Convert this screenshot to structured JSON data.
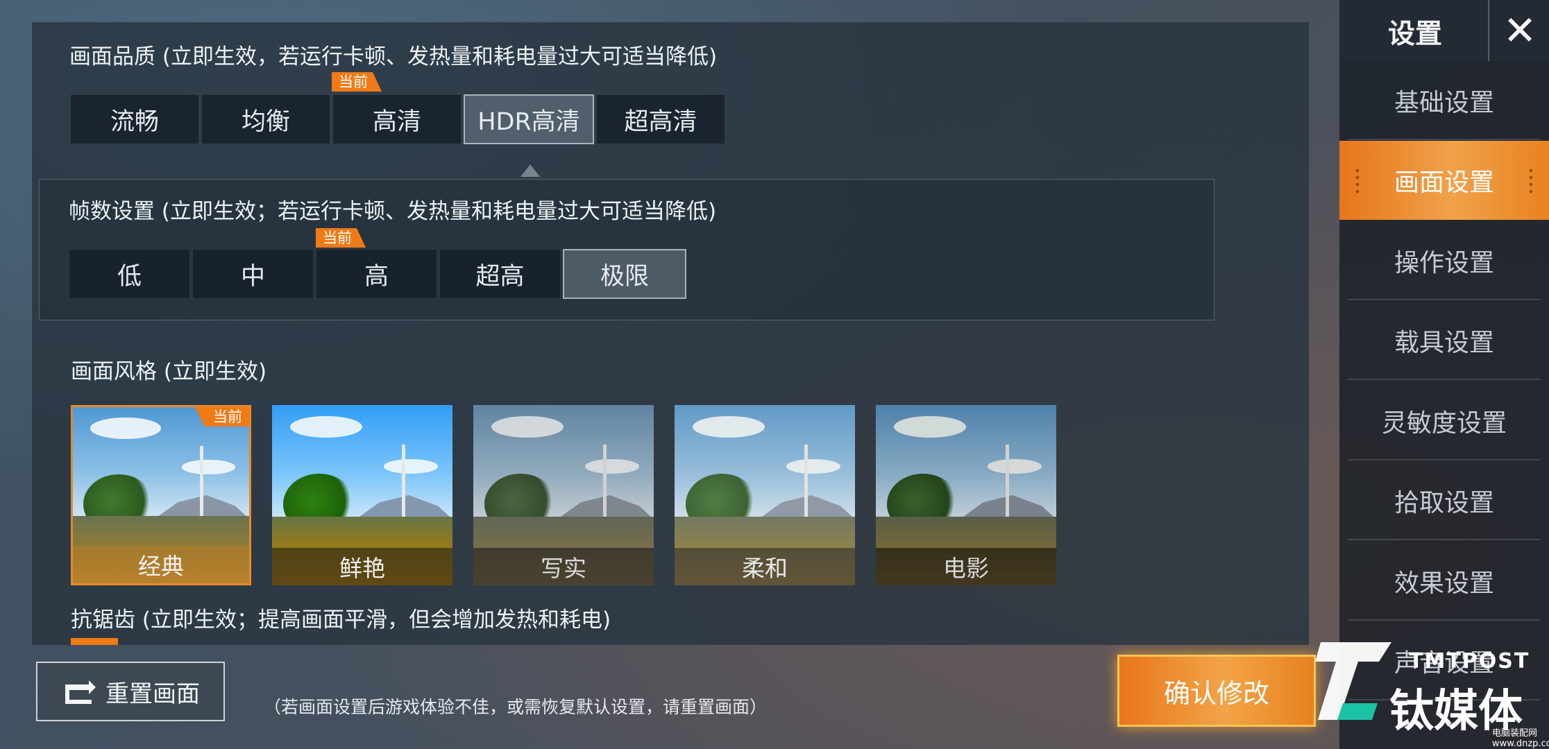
{
  "quality": {
    "title": "画面品质 (立即生效，若运行卡顿、发热量和耗电量过大可适当降低)",
    "options": [
      "流畅",
      "均衡",
      "高清",
      "HDR高清",
      "超高清"
    ],
    "selected": "HDR高清",
    "current_tag": "当前",
    "current": "高清"
  },
  "framerate": {
    "title": "帧数设置 (立即生效；若运行卡顿、发热量和耗电量过大可适当降低)",
    "options": [
      "低",
      "中",
      "高",
      "超高",
      "极限"
    ],
    "selected": "极限",
    "current_tag": "当前",
    "current": "高"
  },
  "style": {
    "title": "画面风格 (立即生效)",
    "options": [
      "经典",
      "鲜艳",
      "写实",
      "柔和",
      "电影"
    ],
    "selected": "经典",
    "current_tag": "当前"
  },
  "antialias": {
    "title": "抗锯齿 (立即生效；提高画面平滑，但会增加发热和耗电)"
  },
  "sidebar": {
    "title": "设置",
    "items": [
      "基础设置",
      "画面设置",
      "操作设置",
      "载具设置",
      "灵敏度设置",
      "拾取设置",
      "效果设置",
      "声音设置"
    ],
    "selected": "画面设置"
  },
  "footer": {
    "reset_label": "重置画面",
    "note": "（若画面设置后游戏体验不佳，或需恢复默认设置，请重置画面）",
    "confirm_label": "确认修改"
  },
  "watermark": {
    "brand_en": "TMTPOST",
    "brand_cn": "钛媒体",
    "small": "电脑装配网 www.dnzp.com"
  },
  "colors": {
    "accent": "#f07a16",
    "panel": "#283440",
    "sidebar": "#181e26"
  }
}
